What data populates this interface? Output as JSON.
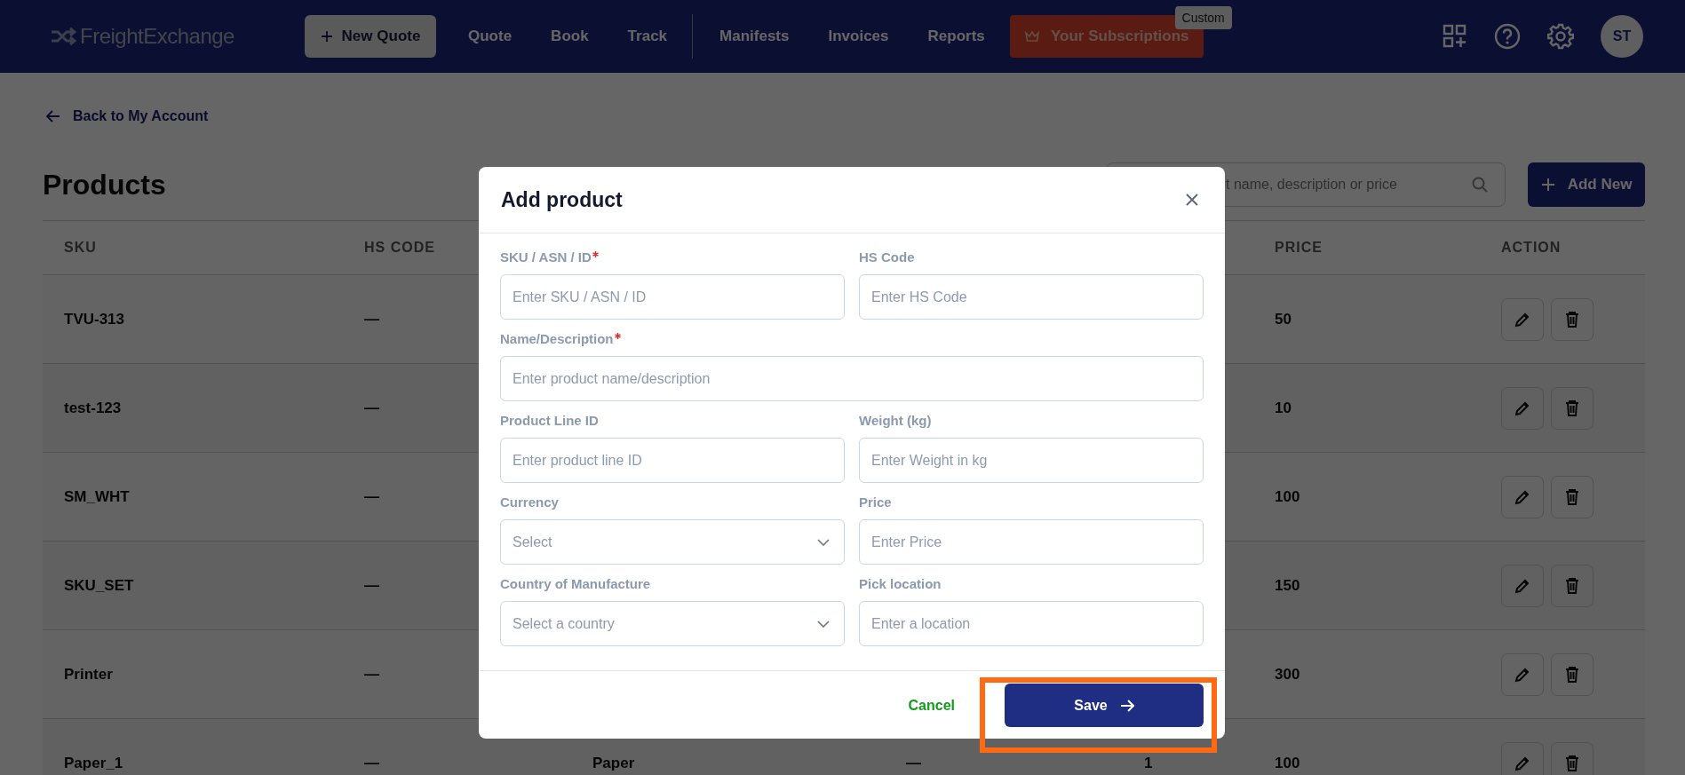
{
  "header": {
    "logo": "FreightExchange",
    "new_quote": "New Quote",
    "nav_primary": [
      "Quote",
      "Book",
      "Track"
    ],
    "nav_secondary": [
      "Manifests",
      "Invoices",
      "Reports"
    ],
    "subscriptions": "Your Subscriptions",
    "plan_badge": "Custom",
    "avatar": "ST"
  },
  "back_link": "Back to My Account",
  "page_title": "Products",
  "search": {
    "placeholder": "t name, description or price"
  },
  "add_button": "Add New",
  "table": {
    "columns": [
      "SKU",
      "HS CODE",
      "",
      "",
      "",
      "PRICE",
      "ACTION"
    ],
    "rows": [
      {
        "sku": "TVU-313",
        "hs_code": "—",
        "column_3": "",
        "column_4": "",
        "column_5": "",
        "price": "50"
      },
      {
        "sku": "test-123",
        "hs_code": "—",
        "column_3": "",
        "column_4": "",
        "column_5": "",
        "price": "10"
      },
      {
        "sku": "SM_WHT",
        "hs_code": "—",
        "column_3": "",
        "column_4": "",
        "column_5": "",
        "price": "100"
      },
      {
        "sku": "SKU_SET",
        "hs_code": "—",
        "column_3": "",
        "column_4": "",
        "column_5": "",
        "price": "150"
      },
      {
        "sku": "Printer",
        "hs_code": "—",
        "column_3": "",
        "column_4": "",
        "column_5": "",
        "price": "300"
      },
      {
        "sku": "Paper_1",
        "hs_code": "—",
        "column_3": "Paper",
        "column_4": "—",
        "column_5": "1",
        "price": "100"
      }
    ]
  },
  "modal": {
    "title": "Add product",
    "fields": [
      {
        "kind": "text",
        "label": "SKU / ASN / ID",
        "required": true,
        "placeholder": "Enter SKU / ASN / ID",
        "wide": false
      },
      {
        "kind": "text",
        "label": "HS Code",
        "required": false,
        "placeholder": "Enter HS Code",
        "wide": false
      },
      {
        "kind": "text",
        "label": "Name/Description",
        "required": true,
        "placeholder": "Enter product name/description",
        "wide": true
      },
      {
        "kind": "text",
        "label": "Product Line ID",
        "required": false,
        "placeholder": "Enter product line ID",
        "wide": false
      },
      {
        "kind": "text",
        "label": "Weight (kg)",
        "required": false,
        "placeholder": "Enter Weight in kg",
        "wide": false
      },
      {
        "kind": "select",
        "label": "Currency",
        "required": false,
        "placeholder": "Select",
        "wide": false
      },
      {
        "kind": "text",
        "label": "Price",
        "required": false,
        "placeholder": "Enter Price",
        "wide": false
      },
      {
        "kind": "select",
        "label": "Country of Manufacture",
        "required": false,
        "placeholder": "Select a country",
        "wide": false
      },
      {
        "kind": "text",
        "label": "Pick location",
        "required": false,
        "placeholder": "Enter a location",
        "wide": false
      }
    ],
    "cancel": "Cancel",
    "save": "Save"
  }
}
